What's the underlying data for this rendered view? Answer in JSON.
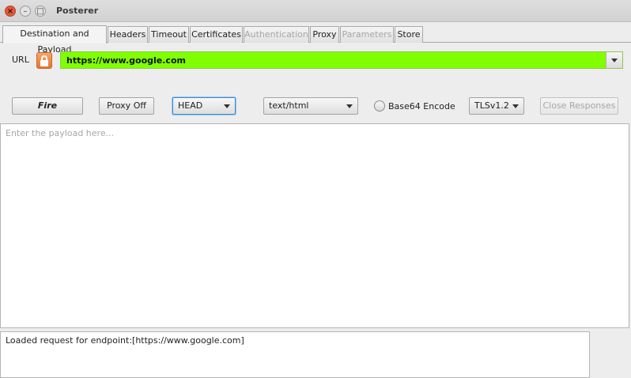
{
  "window": {
    "title": "Posterer"
  },
  "tabs": [
    {
      "label": "Destination and Payload",
      "state": "active"
    },
    {
      "label": "Headers",
      "state": "normal"
    },
    {
      "label": "Timeout",
      "state": "normal"
    },
    {
      "label": "Certificates",
      "state": "normal"
    },
    {
      "label": "Authentication",
      "state": "disabled"
    },
    {
      "label": "Proxy",
      "state": "normal"
    },
    {
      "label": "Parameters",
      "state": "disabled"
    },
    {
      "label": "Store",
      "state": "normal"
    }
  ],
  "url": {
    "label": "URL",
    "value": "https://www.google.com",
    "field_color": "#80ff00"
  },
  "toolbar": {
    "fire_label": "Fire",
    "proxy_label": "Proxy Off",
    "method_value": "HEAD",
    "content_type_value": "text/html",
    "base64_label": "Base64 Encode",
    "base64_checked": false,
    "tls_value": "TLSv1.2",
    "close_responses_label": "Close Responses"
  },
  "payload": {
    "placeholder": "Enter the payload here..."
  },
  "log": {
    "text": "Loaded request for endpoint:[https://www.google.com]"
  },
  "icons": {
    "close": "close-icon",
    "minimize": "minimize-icon",
    "maximize": "maximize-icon",
    "url_lock": "lock-icon"
  }
}
